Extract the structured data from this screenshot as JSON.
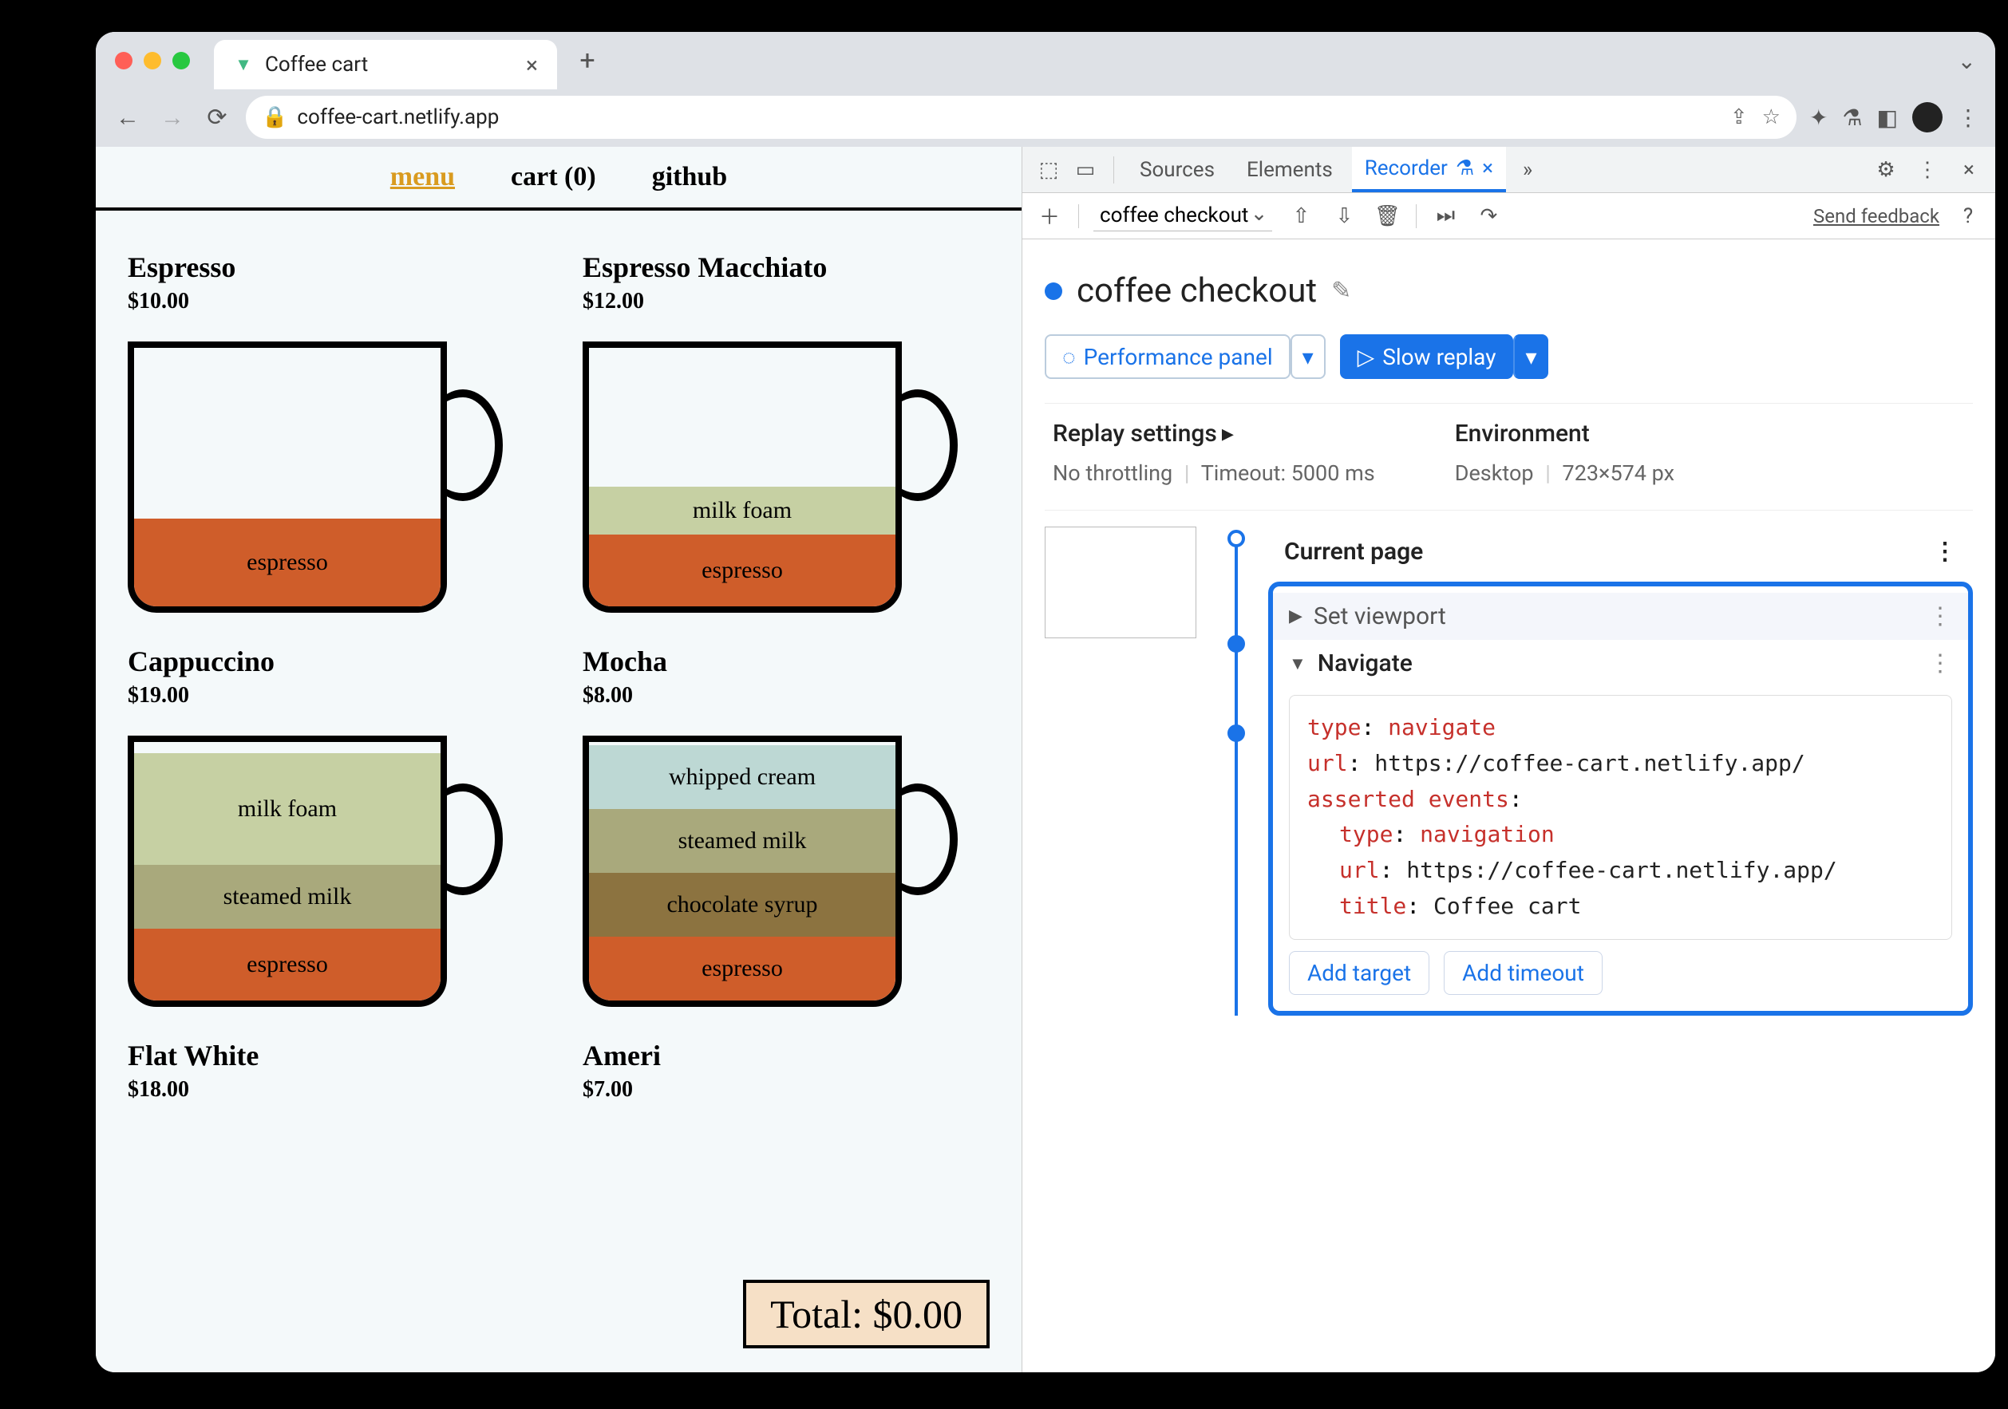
{
  "browser": {
    "tab_title": "Coffee cart",
    "url_display": "coffee-cart.netlify.app"
  },
  "page": {
    "nav": {
      "menu": "menu",
      "cart": "cart (0)",
      "github": "github"
    },
    "products": [
      {
        "name": "Espresso",
        "price": "$10.00"
      },
      {
        "name": "Espresso Macchiato",
        "price": "$12.00"
      },
      {
        "name": "Cappuccino",
        "price": "$19.00"
      },
      {
        "name": "Mocha",
        "price": "$8.00"
      },
      {
        "name": "Flat White",
        "price": "$18.00"
      },
      {
        "name": "Ameri",
        "price": "$7.00"
      }
    ],
    "layers": {
      "espresso": "espresso",
      "milk_foam": "milk foam",
      "steamed_milk": "steamed milk",
      "whipped_cream": "whipped cream",
      "chocolate_syrup": "chocolate syrup"
    },
    "total": "Total: $0.00"
  },
  "devtools": {
    "tabs": {
      "sources": "Sources",
      "elements": "Elements",
      "recorder": "Recorder"
    },
    "toolbar": {
      "dropdown": "coffee checkout",
      "feedback": "Send feedback"
    },
    "recording": {
      "name": "coffee checkout",
      "perf_btn": "Performance panel",
      "replay_btn": "Slow replay"
    },
    "settings": {
      "replay_h": "Replay settings",
      "throttling": "No throttling",
      "timeout": "Timeout: 5000 ms",
      "env_h": "Environment",
      "env_device": "Desktop",
      "env_size": "723×574 px"
    },
    "steps": {
      "current_page": "Current page",
      "set_viewport": "Set viewport",
      "navigate": "Navigate",
      "details": {
        "type_k": "type",
        "type_v": "navigate",
        "url_k": "url",
        "url_v": "https://coffee-cart.netlify.app/",
        "ae_k": "asserted events",
        "nav_type_k": "type",
        "nav_type_v": "navigation",
        "nav_url_k": "url",
        "nav_url_v": "https://coffee-cart.netlify.app/",
        "title_k": "title",
        "title_v": "Coffee cart"
      },
      "add_target": "Add target",
      "add_timeout": "Add timeout"
    }
  }
}
